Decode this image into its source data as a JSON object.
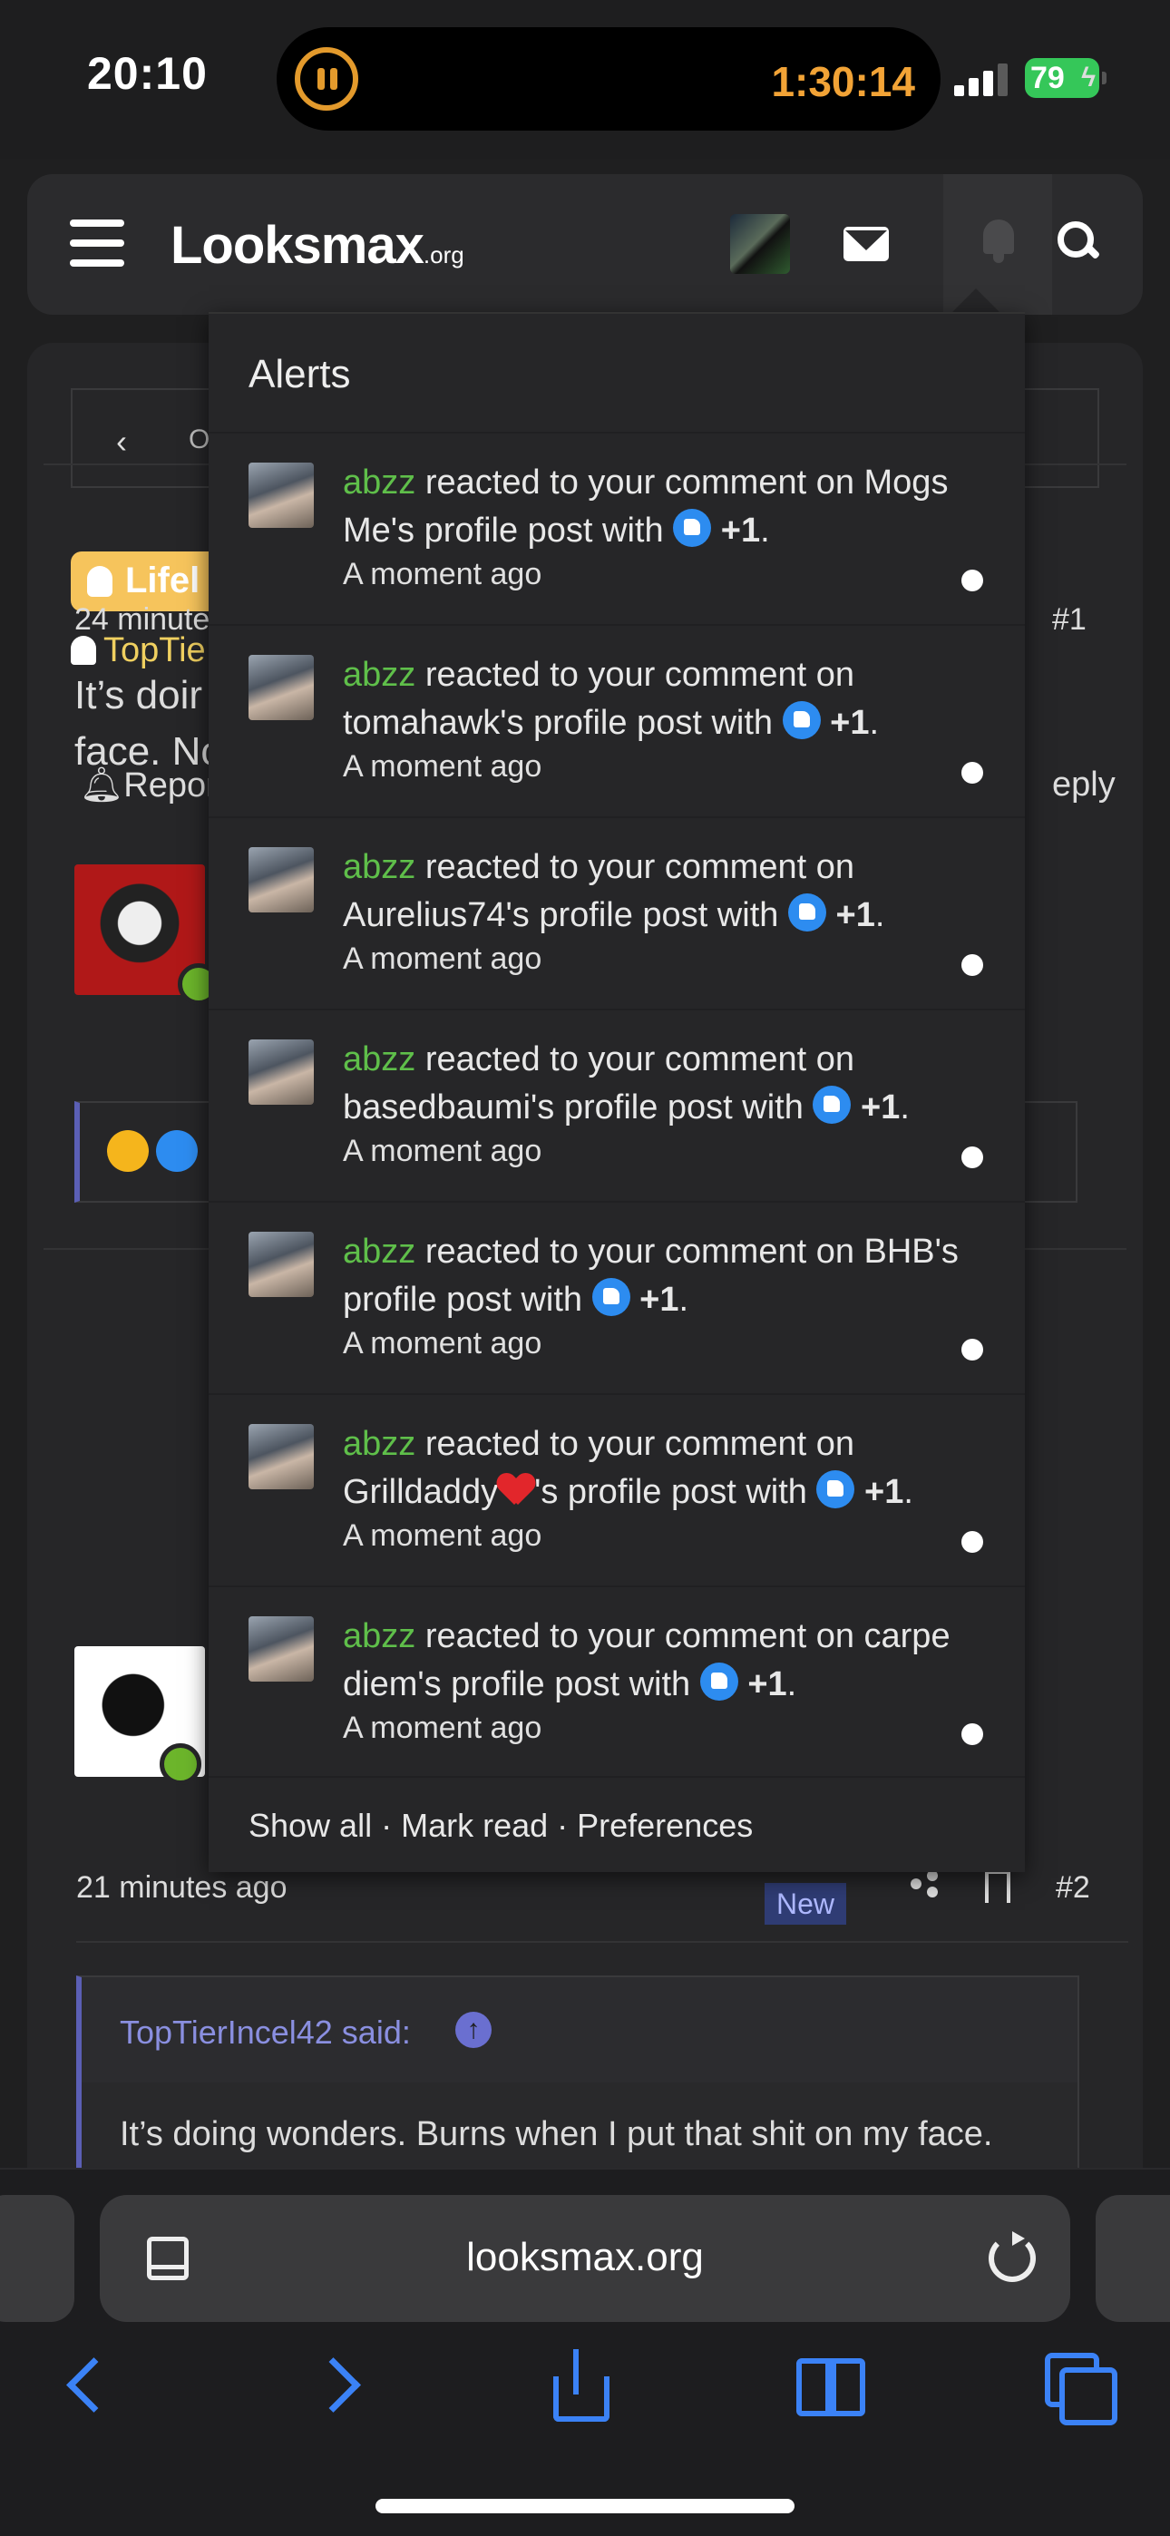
{
  "status_bar": {
    "time": "20:10",
    "timer": "1:30:14",
    "battery": "79"
  },
  "header": {
    "logo_main": "Looksmax",
    "logo_suffix": ".org"
  },
  "background": {
    "breadcrumb": "Offt",
    "prefix": "Lifel",
    "thread_starter": "TopTie",
    "post1": {
      "time": "24 minute",
      "number": "#1",
      "text_line1": "It’s doir",
      "text_line2": "face. Nc",
      "report": "Repor",
      "reply": "eply"
    },
    "post2": {
      "time": "21 minutes ago",
      "new_badge": "New",
      "number": "#2"
    },
    "quote": {
      "author": "TopTierIncel42 said:",
      "text": "It’s doing wonders. Burns when I put that shit on my face."
    }
  },
  "alerts": {
    "title": "Alerts",
    "items": [
      {
        "user": "abzz",
        "pre": " reacted to your comment on Mogs Me's profile post with ",
        "reaction": "+1",
        "time": "A moment ago"
      },
      {
        "user": "abzz",
        "pre": " reacted to your comment on tomahawk's profile post with ",
        "reaction": "+1",
        "time": "A moment ago"
      },
      {
        "user": "abzz",
        "pre": " reacted to your comment on Aurelius74's profile post with ",
        "reaction": "+1",
        "time": "A moment ago"
      },
      {
        "user": "abzz",
        "pre": " reacted to your comment on basedbaumi's profile post with ",
        "reaction": "+1",
        "time": "A moment ago"
      },
      {
        "user": "abzz",
        "pre": " reacted to your comment on BHB's profile post with ",
        "reaction": "+1",
        "time": "A moment ago"
      },
      {
        "user": "abzz",
        "pre_a": " reacted to your comment on Grilldaddy",
        "pre_b": "'s profile post with ",
        "reaction": "+1",
        "time": "A moment ago"
      },
      {
        "user": "abzz",
        "pre": " reacted to your comment on carpe diem's profile post with ",
        "reaction": "+1",
        "time": "A moment ago"
      }
    ],
    "footer": {
      "show_all": "Show all",
      "sep": " · ",
      "mark_read": "Mark read",
      "preferences": "Preferences"
    }
  },
  "browser": {
    "url": "looksmax.org"
  },
  "colors": {
    "user": "#5fbf4a",
    "accent": "#3b82f6",
    "like": "#2d8cf0",
    "unread_dot": "#ffffff"
  }
}
